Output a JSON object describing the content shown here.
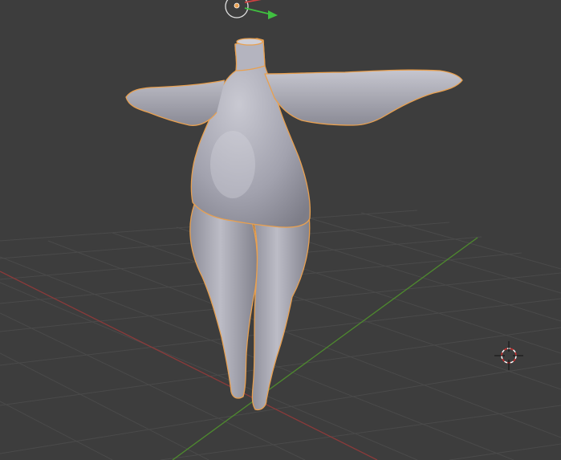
{
  "viewport": {
    "background": "#3d3d3d",
    "grid_color": "#4a4a4a",
    "x_axis_color": "#8a3a3a",
    "y_axis_color": "#4e8a2e",
    "selection_outline_color": "#e8a050"
  },
  "object": {
    "kind": "human body mesh (headless, handless)",
    "color": "#9a9aa6",
    "selected": true
  },
  "gizmo": {
    "origin_color": "#e8a050",
    "arrow_x_color": "#d04040",
    "arrow_y_color": "#40c040"
  },
  "cursor": {
    "icon": "3d-cursor-icon"
  }
}
